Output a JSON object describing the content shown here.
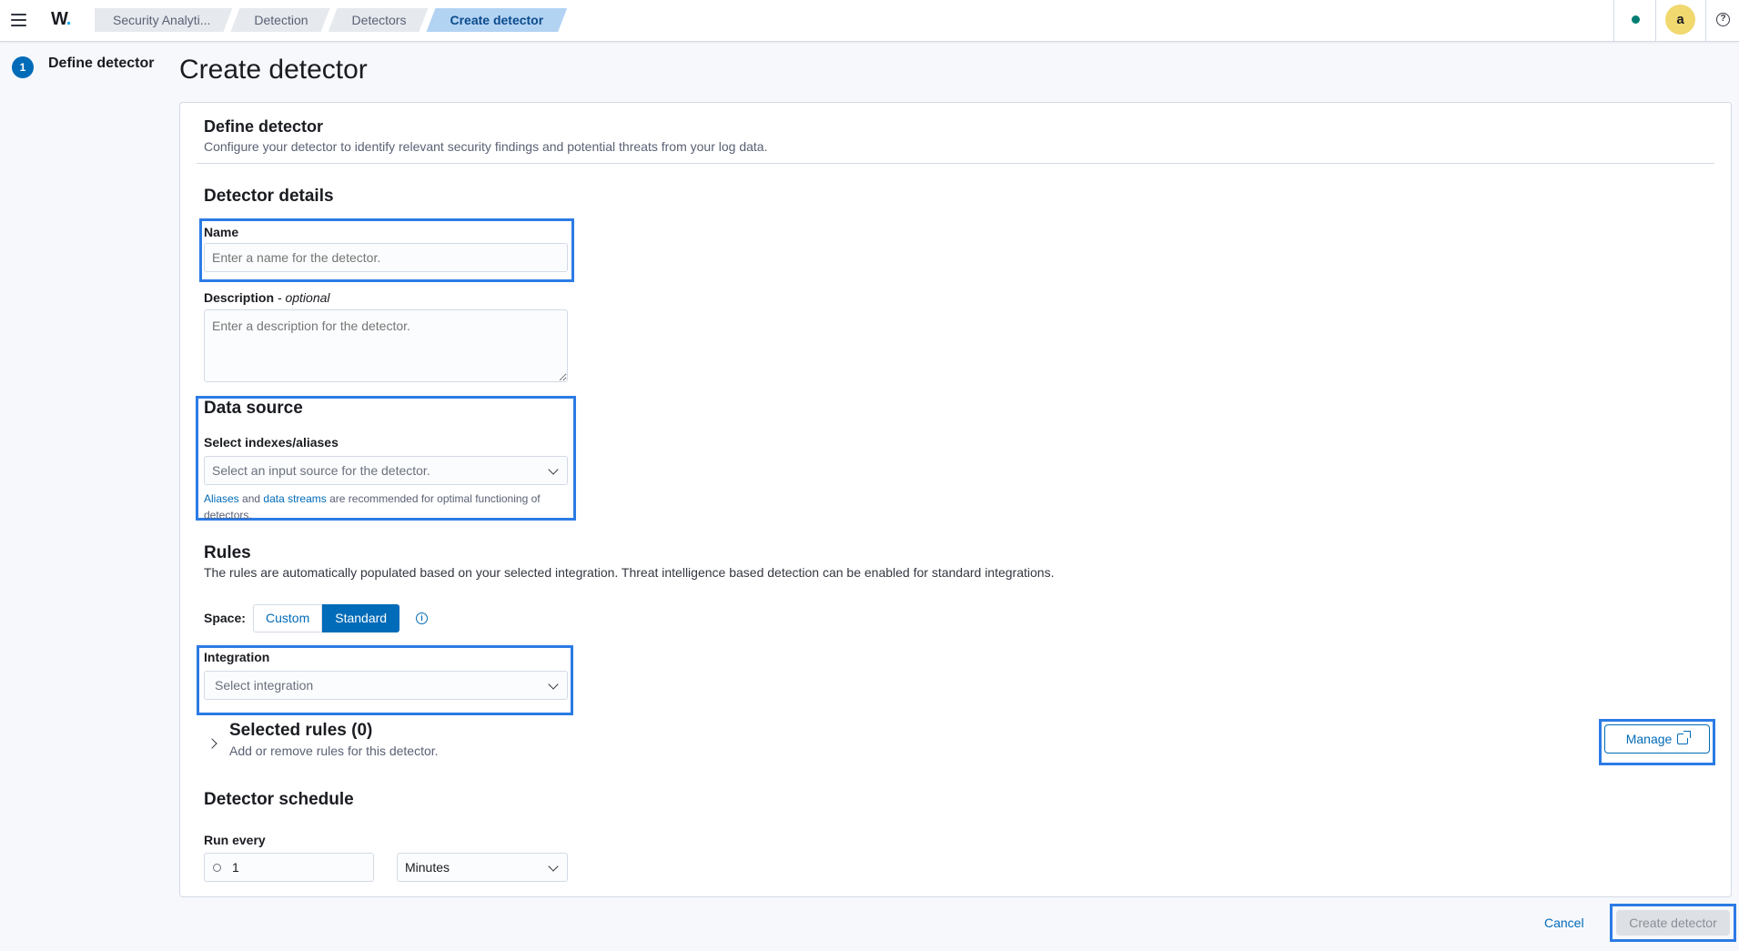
{
  "header": {
    "logo_text": "W",
    "logo_dot": ".",
    "breadcrumbs": [
      "Security Analyti...",
      "Detection",
      "Detectors",
      "Create detector"
    ],
    "avatar_initial": "a",
    "help_glyph": "?"
  },
  "steps": [
    {
      "number": "1",
      "label": "Define detector"
    }
  ],
  "page_title": "Create detector",
  "define": {
    "title": "Define detector",
    "description": "Configure your detector to identify relevant security findings and potential threats from your log data."
  },
  "details": {
    "title": "Detector details",
    "name_label": "Name",
    "name_placeholder": "Enter a name for the detector.",
    "description_label": "Description",
    "description_optional": "- optional",
    "description_placeholder": "Enter a description for the detector."
  },
  "data_source": {
    "title": "Data source",
    "select_label": "Select indexes/aliases",
    "select_placeholder": "Select an input source for the detector.",
    "help_link1": "Aliases",
    "help_and": "and",
    "help_link2": "data streams",
    "help_rest": "are recommended for optimal functioning of",
    "help_rest2": "detectors."
  },
  "rules": {
    "title": "Rules",
    "description": "The rules are automatically populated based on your selected integration. Threat intelligence based detection can be enabled for standard integrations.",
    "space_label": "Space:",
    "space_options": [
      "Custom",
      "Standard"
    ],
    "space_selected": "Standard",
    "integration_label": "Integration",
    "integration_placeholder": "Select integration",
    "selected_rules_title": "Selected rules (0)",
    "selected_rules_sub": "Add or remove rules for this detector.",
    "manage_label": "Manage"
  },
  "schedule": {
    "title": "Detector schedule",
    "run_every_label": "Run every",
    "interval_value": "1",
    "unit_value": "Minutes"
  },
  "footer": {
    "cancel_label": "Cancel",
    "create_label": "Create detector"
  },
  "colors": {
    "accent": "#006bb8",
    "highlight": "#2c7be5",
    "status_dot": "#017d73",
    "avatar_bg": "#f1d86f"
  }
}
